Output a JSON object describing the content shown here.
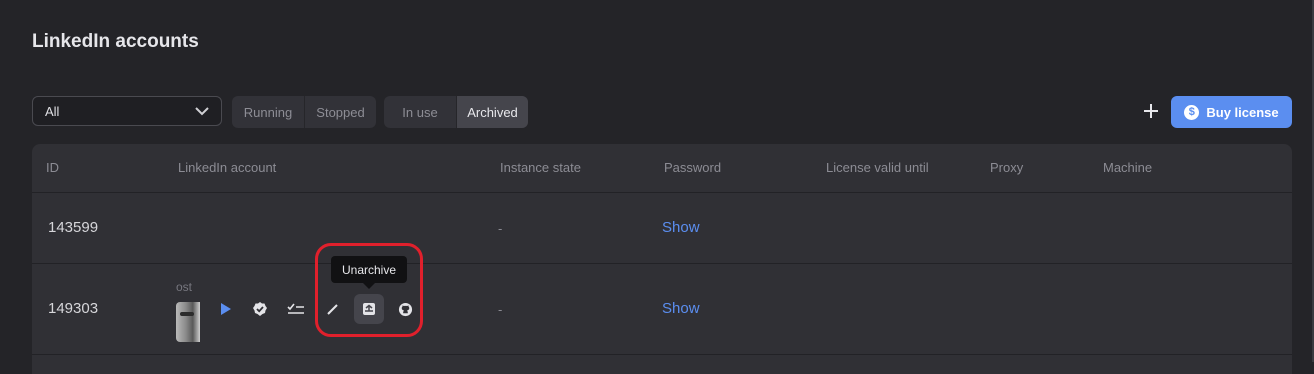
{
  "page": {
    "title": "LinkedIn accounts"
  },
  "filters": {
    "account_select": {
      "value": "All"
    },
    "run_state": [
      "Running",
      "Stopped"
    ],
    "usage": [
      {
        "label": "In use",
        "active": false
      },
      {
        "label": "Archived",
        "active": true
      }
    ]
  },
  "actions": {
    "buy_license": "Buy license",
    "buy_icon_glyph": "$"
  },
  "table": {
    "columns": [
      "ID",
      "LinkedIn account",
      "Instance state",
      "Password",
      "License valid until",
      "Proxy",
      "Machine"
    ],
    "rows": [
      {
        "id": "143599",
        "account": "",
        "instance_state": "-",
        "password_link": "Show"
      },
      {
        "id": "149303",
        "account": "ost",
        "instance_state": "-",
        "password_link": "Show"
      }
    ]
  },
  "tooltip": {
    "text": "Unarchive"
  },
  "row_actions": [
    "play-icon",
    "verified-icon",
    "checklist-icon",
    "edit-pencil-icon",
    "unarchive-icon",
    "github-icon"
  ],
  "colors": {
    "accent": "#5b8ef0",
    "background": "#242428",
    "table": "#303035",
    "highlight": "#e0202c"
  }
}
